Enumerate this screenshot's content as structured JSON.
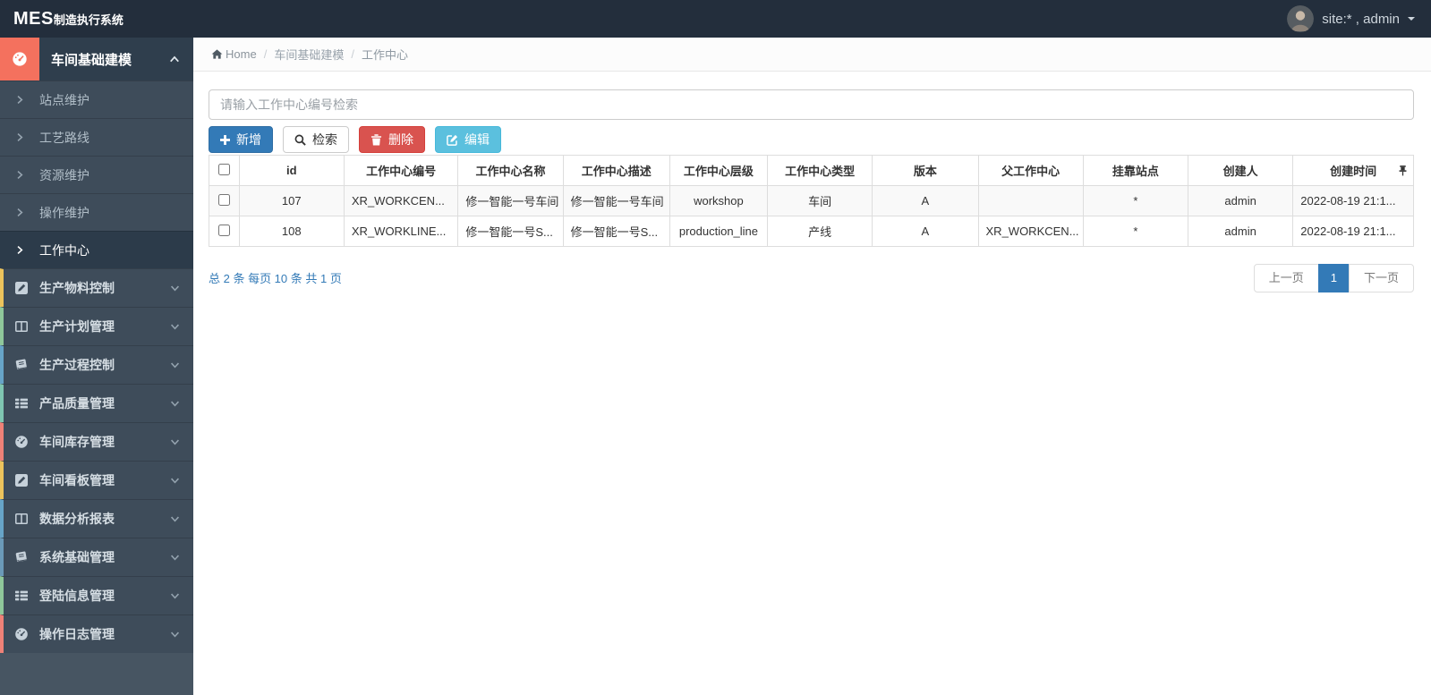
{
  "header": {
    "logo_primary": "MES",
    "logo_suffix": "制造执行系统",
    "user_label": "site:* , admin"
  },
  "sidebar": {
    "parent": {
      "label": "车间基础建模",
      "icon": "gauge-icon",
      "accent": "#f4715e"
    },
    "submenu": [
      {
        "label": "站点维护"
      },
      {
        "label": "工艺路线"
      },
      {
        "label": "资源维护"
      },
      {
        "label": "操作维护"
      },
      {
        "label": "工作中心",
        "active": true
      }
    ],
    "sections": [
      {
        "label": "生产物料控制",
        "icon": "pencil-square-icon",
        "accent": "#ecc35c"
      },
      {
        "label": "生产计划管理",
        "icon": "columns-icon",
        "accent": "#8fc79a"
      },
      {
        "label": "生产过程控制",
        "icon": "book-icon",
        "accent": "#67a4c7"
      },
      {
        "label": "产品质量管理",
        "icon": "th-list-icon",
        "accent": "#7fc6b1"
      },
      {
        "label": "车间库存管理",
        "icon": "gauge-icon",
        "accent": "#ee8177"
      },
      {
        "label": "车间看板管理",
        "icon": "pencil-square-icon",
        "accent": "#ecc35c"
      },
      {
        "label": "数据分析报表",
        "icon": "columns-icon",
        "accent": "#67a4c7"
      },
      {
        "label": "系统基础管理",
        "icon": "book-icon",
        "accent": "#6b9ab8"
      },
      {
        "label": "登陆信息管理",
        "icon": "th-list-icon",
        "accent": "#8fc79a"
      },
      {
        "label": "操作日志管理",
        "icon": "gauge-icon",
        "accent": "#ee8177"
      }
    ]
  },
  "breadcrumb": {
    "home": "Home",
    "separator": "/",
    "level1": "车间基础建模",
    "level2": "工作中心"
  },
  "toolbar": {
    "search_placeholder": "请输入工作中心编号检索",
    "add_label": "新增",
    "search_label": "检索",
    "delete_label": "删除",
    "edit_label": "编辑"
  },
  "table": {
    "headers": [
      "id",
      "工作中心编号",
      "工作中心名称",
      "工作中心描述",
      "工作中心层级",
      "工作中心类型",
      "版本",
      "父工作中心",
      "挂靠站点",
      "创建人",
      "创建时间"
    ],
    "rows": [
      {
        "cells": [
          "107",
          "XR_WORKCEN...",
          "修一智能一号车间",
          "修一智能一号车间",
          "workshop",
          "车间",
          "A",
          "",
          "*",
          "admin",
          "2022-08-19 21:1..."
        ]
      },
      {
        "cells": [
          "108",
          "XR_WORKLINE...",
          "修一智能一号S...",
          "修一智能一号S...",
          "production_line",
          "产线",
          "A",
          "XR_WORKCEN...",
          "*",
          "admin",
          "2022-08-19 21:1..."
        ]
      }
    ]
  },
  "pagination": {
    "summary": "总 2 条 每页 10 条 共 1 页",
    "prev_label": "上一页",
    "page_current": "1",
    "next_label": "下一页"
  },
  "colors": {
    "topbar_bg": "#232e3c",
    "sidebar_bg": "#475562",
    "sidebar_item_bg": "#3e4c5a",
    "sidebar_active_bg": "#2c3b4a",
    "active_icon_accent": "#f4715e",
    "primary_button": "#337ab7",
    "danger_button": "#d9534f",
    "info_button": "#5bc0de",
    "pagination_active": "#337ab7"
  }
}
